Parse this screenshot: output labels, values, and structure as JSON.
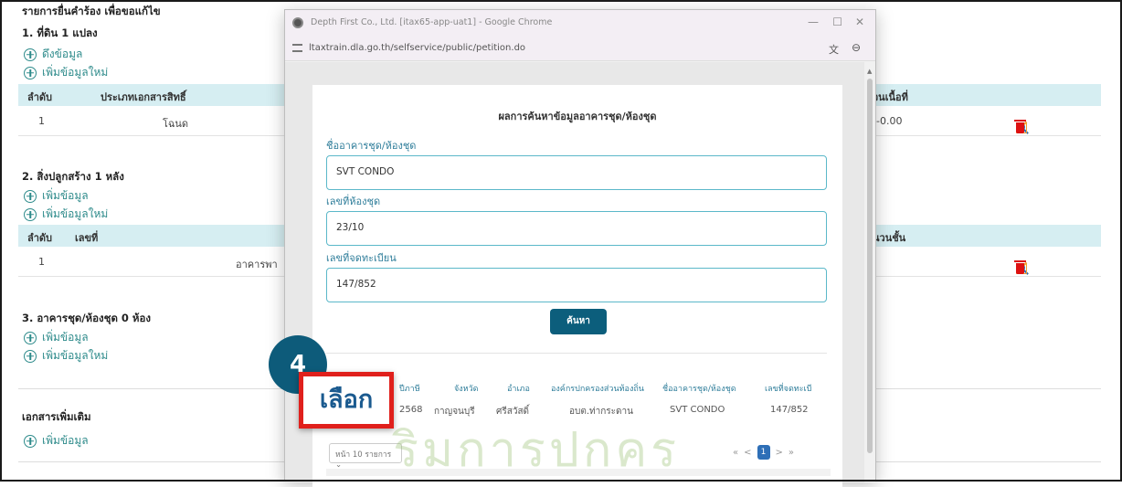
{
  "page": {
    "heading": "รายการยื่นคำร้อง เพื่อขอแก้ไข",
    "section1": {
      "title": "1. ที่ดิน 1 แปลง",
      "links": [
        "ดึงข้อมูล",
        "เพิ่มข้อมูลใหม่"
      ],
      "headers": [
        "ลำดับ",
        "ประเภทเอกสารสิทธิ์",
        "วนเนื้อที่"
      ],
      "row": [
        "1",
        "โฉนด",
        "0-0.00"
      ]
    },
    "section2": {
      "title": "2. สิ่งปลูกสร้าง 1 หลัง",
      "links": [
        "เพิ่มข้อมูล",
        "เพิ่มข้อมูลใหม่"
      ],
      "headers": [
        "ลำดับ",
        "เลขที่",
        "นวนชั้น"
      ],
      "row": [
        "1",
        "อาคารพา"
      ]
    },
    "section3": {
      "title": "3. อาคารชุด/ห้องชุด 0 ห้อง",
      "links": [
        "เพิ่มข้อมูล",
        "เพิ่มข้อมูลใหม่"
      ]
    },
    "section4": {
      "title": "เอกสารเพิ่มเติม",
      "links": [
        "เพิ่มข้อมูล"
      ]
    },
    "watermark": "ริมการปกคร"
  },
  "popup": {
    "window_title": "Depth First Co., Ltd. [itax65-app-uat1] - Google Chrome",
    "url": "ltaxtrain.dla.go.th/selfservice/public/petition.do",
    "form_title": "ผลการค้นหาข้อมูลอาคารชุด/ห้องชุด",
    "fields": [
      {
        "label": "ชื่ออาคารชุด/ห้องชุด",
        "value": "SVT CONDO"
      },
      {
        "label": "เลขที่ห้องชุด",
        "value": "23/10"
      },
      {
        "label": "เลขที่จดทะเบียน",
        "value": "147/852"
      }
    ],
    "search_button": "ค้นหา",
    "result_headers": [
      "ปีภาษี",
      "จังหวัด",
      "อำเภอ",
      "องค์กรปกครองส่วนท้องถิ่น",
      "ชื่ออาคารชุด/ห้องชุด",
      "เลขที่จดทะเบี"
    ],
    "result_row": [
      "2568",
      "กาญจนบุรี",
      "ศรีสวัสดิ์",
      "อบต.ท่ากระดาน",
      "SVT CONDO",
      "147/852"
    ],
    "page_size": "หน้า 10 รายการ",
    "pager": {
      "first": "«",
      "prev": "<",
      "current": "1",
      "next": ">",
      "last": "»"
    }
  },
  "step_number": "4",
  "select_label": "เลือก"
}
